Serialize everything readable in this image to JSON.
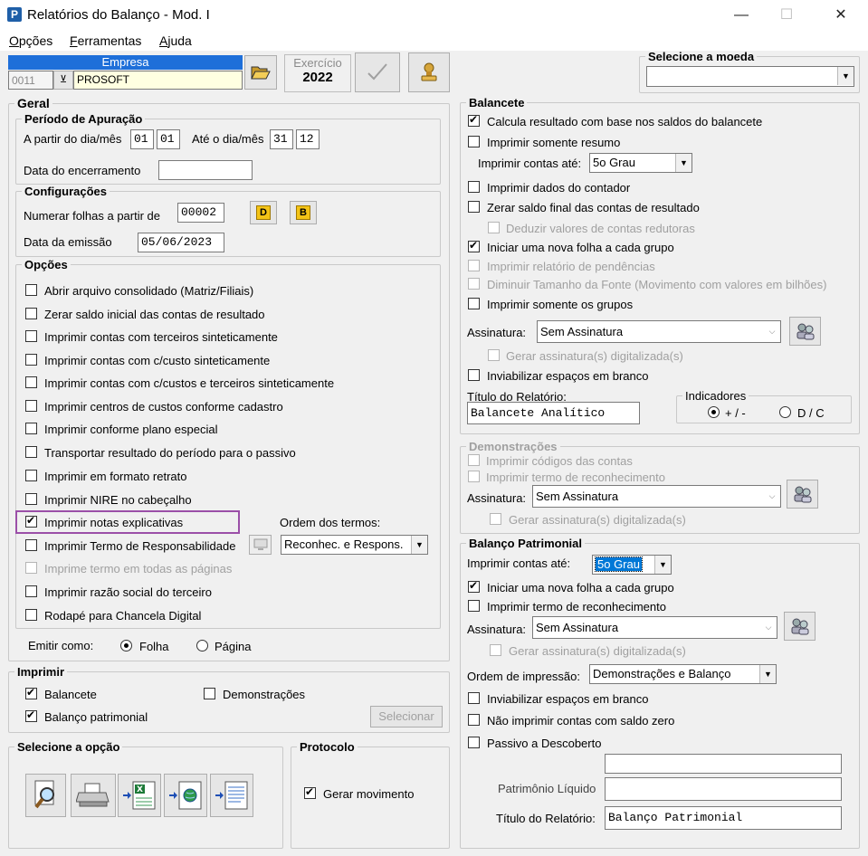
{
  "window": {
    "title": "Relatórios do Balanço - Mod. I",
    "app_icon": "P",
    "minimize": "—",
    "maximize": "☐",
    "close": "✕"
  },
  "menu": [
    {
      "pre": "",
      "key": "O",
      "post": "pções"
    },
    {
      "pre": "",
      "key": "F",
      "post": "erramentas"
    },
    {
      "pre": "",
      "key": "A",
      "post": "juda"
    }
  ],
  "empresa": {
    "header": "Empresa",
    "code": "0011",
    "name": "PROSOFT"
  },
  "exercicio": {
    "label": "Exercício",
    "year": "2022"
  },
  "moeda": {
    "legend": "Selecione a moeda",
    "value": ""
  },
  "geral": {
    "legend": "Geral",
    "periodo": {
      "legend": "Período de Apuração",
      "from_label": "A partir do dia/mês",
      "from_day": "01",
      "from_month": "01",
      "to_label": "Até o dia/mês",
      "to_day": "31",
      "to_month": "12",
      "encerramento_label": "Data do encerramento",
      "encerramento_value": ""
    },
    "config": {
      "legend": "Configurações",
      "folhas_label": "Numerar folhas a partir de",
      "folhas_value": "00002",
      "btn_d": "D",
      "btn_b": "B",
      "emissao_label": "Data da emissão",
      "emissao_value": "05/06/2023"
    },
    "opcoes": {
      "legend": "Opções",
      "items": [
        {
          "label": "Abrir arquivo consolidado (Matriz/Filiais)",
          "checked": false,
          "enabled": true
        },
        {
          "label": "Zerar saldo inicial das contas de resultado",
          "checked": false,
          "enabled": true
        },
        {
          "label": "Imprimir contas com terceiros sinteticamente",
          "checked": false,
          "enabled": true
        },
        {
          "label": "Imprimir contas com c/custo sinteticamente",
          "checked": false,
          "enabled": true
        },
        {
          "label": "Imprimir contas com c/custos e terceiros sinteticamente",
          "checked": false,
          "enabled": true
        },
        {
          "label": "Imprimir centros de custos conforme cadastro",
          "checked": false,
          "enabled": true
        },
        {
          "label": "Imprimir conforme plano especial",
          "checked": false,
          "enabled": true
        },
        {
          "label": "Transportar resultado do período para o passivo",
          "checked": false,
          "enabled": true
        },
        {
          "label": "Imprimir em formato retrato",
          "checked": false,
          "enabled": true
        },
        {
          "label": "Imprimir NIRE no cabeçalho",
          "checked": false,
          "enabled": true
        },
        {
          "label": "Imprimir notas explicativas",
          "checked": true,
          "enabled": true
        },
        {
          "label": "Imprimir Termo de Responsabilidade",
          "checked": false,
          "enabled": true
        },
        {
          "label": "Imprime termo em todas as páginas",
          "checked": false,
          "enabled": false
        },
        {
          "label": "Imprimir razão social do terceiro",
          "checked": false,
          "enabled": true
        },
        {
          "label": "Rodapé para Chancela Digital",
          "checked": false,
          "enabled": true
        }
      ],
      "ordem_label": "Ordem dos termos:",
      "ordem_value": "Reconhec. e Respons."
    },
    "emitir": {
      "label": "Emitir como:",
      "folha": "Folha",
      "pagina": "Página",
      "selected": "Folha"
    }
  },
  "imprimir": {
    "legend": "Imprimir",
    "balancete": "Balancete",
    "balancete_checked": true,
    "demonstracoes": "Demonstrações",
    "demonstracoes_checked": false,
    "balanco": "Balanço patrimonial",
    "balanco_checked": true,
    "selecionar": "Selecionar"
  },
  "selecione_opcao": {
    "legend": "Selecione a opção"
  },
  "protocolo": {
    "legend": "Protocolo",
    "gerar": "Gerar movimento",
    "gerar_checked": true
  },
  "balancete": {
    "legend": "Balancete",
    "items": [
      {
        "label": "Calcula resultado com base nos saldos do balancete",
        "checked": true,
        "enabled": true
      },
      {
        "label": "Imprimir somente resumo",
        "checked": false,
        "enabled": true
      }
    ],
    "contas_label": "Imprimir contas até:",
    "contas_value": "5o Grau",
    "items2": [
      {
        "label": "Imprimir dados do contador",
        "checked": false,
        "enabled": true
      },
      {
        "label": "Zerar saldo final das contas de resultado",
        "checked": false,
        "enabled": true
      },
      {
        "label": "Deduzir valores de contas redutoras",
        "checked": false,
        "enabled": false
      },
      {
        "label": "Iniciar uma nova folha a cada grupo",
        "checked": true,
        "enabled": true
      },
      {
        "label": "Imprimir relatório de pendências",
        "checked": false,
        "enabled": false
      },
      {
        "label": "Diminuir Tamanho da Fonte (Movimento com valores em bilhões)",
        "checked": false,
        "enabled": false
      },
      {
        "label": "Imprimir somente os grupos",
        "checked": false,
        "enabled": true
      }
    ],
    "assinatura_label": "Assinatura:",
    "assinatura_value": "Sem Assinatura",
    "gerar_assinatura": "Gerar assinatura(s) digitalizada(s)",
    "inviabilizar": "Inviabilizar espaços em branco",
    "titulo_label": "Título do Relatório:",
    "titulo_value": "Balancete Analítico",
    "indicadores": {
      "legend": "Indicadores",
      "opt1": "+ / -",
      "opt2": "D / C",
      "selected": "+ / -"
    }
  },
  "demonstracoes": {
    "legend": "Demonstrações",
    "codigos": "Imprimir códigos das contas",
    "termo": "Imprimir termo de reconhecimento",
    "assinatura_label": "Assinatura:",
    "assinatura_value": "Sem Assinatura",
    "gerar_assinatura": "Gerar assinatura(s) digitalizada(s)"
  },
  "balanco": {
    "legend": "Balanço Patrimonial",
    "contas_label": "Imprimir contas até:",
    "contas_value": "5o Grau",
    "nova_folha": "Iniciar uma nova folha a cada grupo",
    "nova_folha_checked": true,
    "termo": "Imprimir termo de reconhecimento",
    "assinatura_label": "Assinatura:",
    "assinatura_value": "Sem Assinatura",
    "gerar_assinatura": "Gerar assinatura(s) digitalizada(s)",
    "ordem_label": "Ordem de impressão:",
    "ordem_value": "Demonstrações e Balanço",
    "inviabilizar": "Inviabilizar espaços em branco",
    "nao_imprimir": "Não imprimir contas com saldo zero",
    "passivo": "Passivo a Descoberto",
    "passivo_value": "",
    "patrimonio_label": "Patrimônio Líquido",
    "patrimonio_value": "",
    "titulo_label": "Título do Relatório:",
    "titulo_value": "Balanço Patrimonial"
  },
  "colors": {
    "accent": "#1e6fd9",
    "highlight": "#9b4fa8",
    "selection": "#0078d7"
  }
}
